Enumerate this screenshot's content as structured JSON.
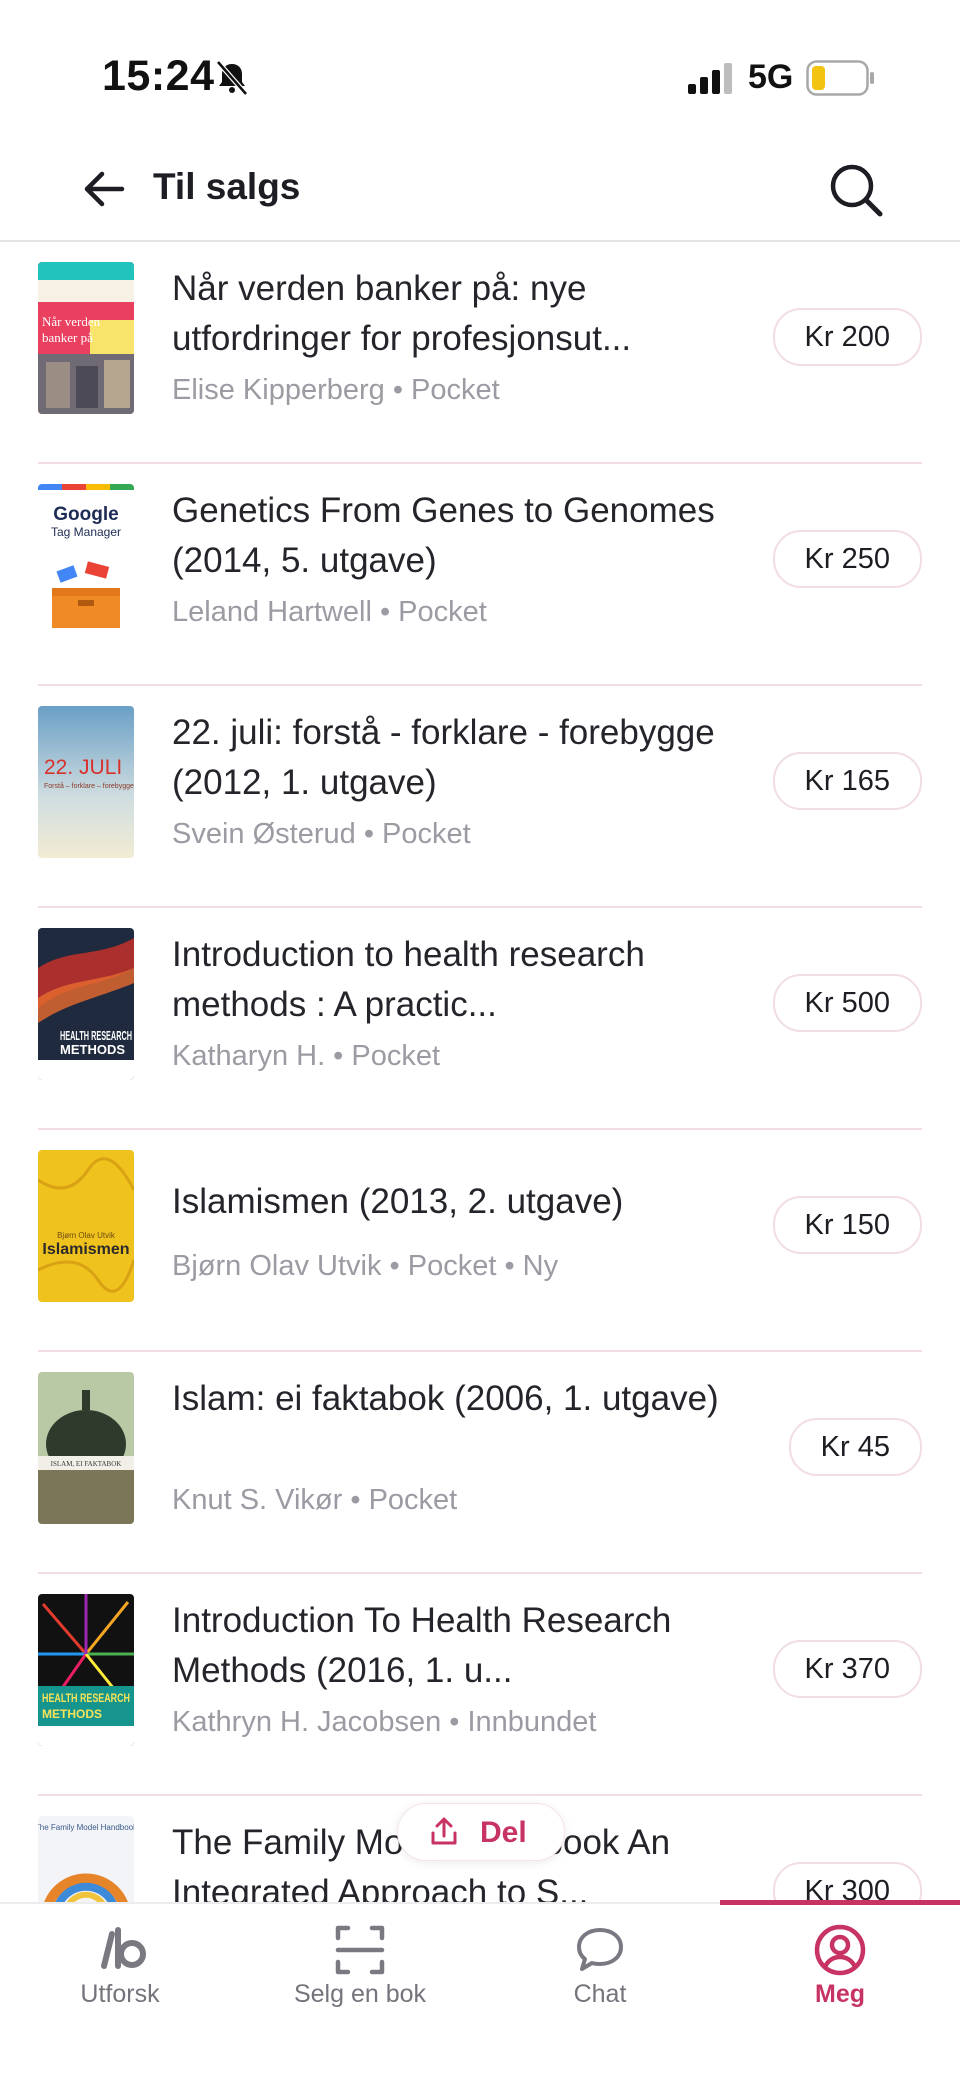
{
  "status_bar": {
    "time": "15:24",
    "network": "5G",
    "battery_color": "#f2c40f"
  },
  "header": {
    "title": "Til salgs",
    "back_icon": "arrow-left-icon",
    "search_icon": "search-icon"
  },
  "listings": [
    {
      "title": "Når verden banker på: nye utfordringer for profesjonsut...",
      "author": "Elise Kipperberg",
      "format": "Pocket",
      "meta": "Elise Kipperberg • Pocket",
      "price": "Kr 200",
      "cover_texts": [
        "Når verden",
        "banker på"
      ]
    },
    {
      "title": "Genetics From Genes to Genomes (2014, 5. utgave)",
      "author": "Leland Hartwell",
      "format": "Pocket",
      "meta": "Leland Hartwell • Pocket",
      "price": "Kr 250",
      "cover_texts": [
        "Google",
        "Tag Manager"
      ]
    },
    {
      "title": "22. juli: forstå - forklare - forebygge (2012, 1. utgave)",
      "author": "Svein Østerud",
      "format": "Pocket",
      "meta": "Svein Østerud • Pocket",
      "price": "Kr 165",
      "cover_texts": [
        "22. JULI",
        "Forstå – forklare – forebygge"
      ]
    },
    {
      "title": "Introduction to health research methods : A practic...",
      "author": "Katharyn H.",
      "format": "Pocket",
      "meta": "Katharyn H. • Pocket",
      "price": "Kr 500",
      "cover_texts": [
        "HEALTH RESEARCH",
        "METHODS"
      ]
    },
    {
      "title": "Islamismen (2013, 2. utgave)",
      "author": "Bjørn Olav Utvik",
      "format": "Pocket",
      "condition": "Ny",
      "meta": "Bjørn Olav Utvik • Pocket • Ny",
      "price": "Kr 150",
      "cover_texts": [
        "Bjørn Olav Utvik",
        "Islamismen"
      ]
    },
    {
      "title": "Islam: ei faktabok (2006, 1. utgave)",
      "author": "Knut S. Vikør",
      "format": "Pocket",
      "meta": "Knut S. Vikør • Pocket",
      "price": "Kr 45",
      "cover_texts": [
        "ISLAM, EI FAKTABOK"
      ]
    },
    {
      "title": "Introduction To Health Research Methods (2016, 1. u...",
      "author": "Kathryn H. Jacobsen",
      "format": "Innbundet",
      "meta": "Kathryn H. Jacobsen • Innbundet",
      "price": "Kr 370",
      "cover_texts": [
        "HEALTH RESEARCH",
        "METHODS"
      ]
    },
    {
      "title": "The Family Model Handbook An Integrated Approach to S...",
      "author": "",
      "format": "",
      "meta": "",
      "price": "Kr 300",
      "cover_texts": [
        "The Family Model Handbook"
      ]
    }
  ],
  "share_button": {
    "label": "Del",
    "icon": "share-icon"
  },
  "bottom_nav": {
    "accent_color": "#c73363",
    "items": [
      {
        "label": "Utforsk",
        "icon": "explore-logo-icon",
        "active": false
      },
      {
        "label": "Selg en bok",
        "icon": "scan-icon",
        "active": false
      },
      {
        "label": "Chat",
        "icon": "chat-bubble-icon",
        "active": false
      },
      {
        "label": "Meg",
        "icon": "profile-icon",
        "active": true
      }
    ]
  }
}
